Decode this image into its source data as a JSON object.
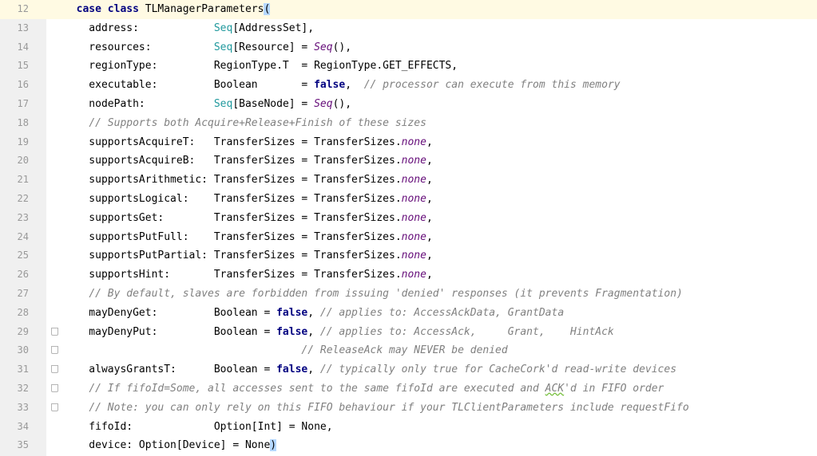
{
  "editor": {
    "current_line": 12,
    "lines": [
      {
        "n": "12",
        "t": [
          [
            "",
            "  "
          ],
          [
            "kw",
            "case"
          ],
          [
            "",
            " "
          ],
          [
            "kw",
            "class"
          ],
          [
            "",
            " TLManagerParameters"
          ],
          [
            "caret",
            "("
          ]
        ]
      },
      {
        "n": "13",
        "t": [
          [
            "",
            "    address:            "
          ],
          [
            "ty",
            "Seq"
          ],
          [
            "",
            "[AddressSet],"
          ]
        ]
      },
      {
        "n": "14",
        "t": [
          [
            "",
            "    resources:          "
          ],
          [
            "ty",
            "Seq"
          ],
          [
            "",
            "[Resource] = "
          ],
          [
            "it",
            "Seq"
          ],
          [
            "",
            "(),"
          ]
        ]
      },
      {
        "n": "15",
        "t": [
          [
            "",
            "    regionType:         RegionType.T  = RegionType.GET_EFFECTS,"
          ]
        ]
      },
      {
        "n": "16",
        "t": [
          [
            "",
            "    executable:         Boolean       = "
          ],
          [
            "kw",
            "false"
          ],
          [
            "",
            ",  "
          ],
          [
            "cm",
            "// processor can execute from this memory"
          ]
        ]
      },
      {
        "n": "17",
        "t": [
          [
            "",
            "    nodePath:           "
          ],
          [
            "ty",
            "Seq"
          ],
          [
            "",
            "[BaseNode] = "
          ],
          [
            "it",
            "Seq"
          ],
          [
            "",
            "(),"
          ]
        ]
      },
      {
        "n": "18",
        "t": [
          [
            "",
            "    "
          ],
          [
            "cm",
            "// Supports both Acquire+Release+Finish of these sizes"
          ]
        ]
      },
      {
        "n": "19",
        "t": [
          [
            "",
            "    supportsAcquireT:   TransferSizes = TransferSizes."
          ],
          [
            "it",
            "none"
          ],
          [
            "",
            ","
          ]
        ]
      },
      {
        "n": "20",
        "t": [
          [
            "",
            "    supportsAcquireB:   TransferSizes = TransferSizes."
          ],
          [
            "it",
            "none"
          ],
          [
            "",
            ","
          ]
        ]
      },
      {
        "n": "21",
        "t": [
          [
            "",
            "    supportsArithmetic: TransferSizes = TransferSizes."
          ],
          [
            "it",
            "none"
          ],
          [
            "",
            ","
          ]
        ]
      },
      {
        "n": "22",
        "t": [
          [
            "",
            "    supportsLogical:    TransferSizes = TransferSizes."
          ],
          [
            "it",
            "none"
          ],
          [
            "",
            ","
          ]
        ]
      },
      {
        "n": "23",
        "t": [
          [
            "",
            "    supportsGet:        TransferSizes = TransferSizes."
          ],
          [
            "it",
            "none"
          ],
          [
            "",
            ","
          ]
        ]
      },
      {
        "n": "24",
        "t": [
          [
            "",
            "    supportsPutFull:    TransferSizes = TransferSizes."
          ],
          [
            "it",
            "none"
          ],
          [
            "",
            ","
          ]
        ]
      },
      {
        "n": "25",
        "t": [
          [
            "",
            "    supportsPutPartial: TransferSizes = TransferSizes."
          ],
          [
            "it",
            "none"
          ],
          [
            "",
            ","
          ]
        ]
      },
      {
        "n": "26",
        "t": [
          [
            "",
            "    supportsHint:       TransferSizes = TransferSizes."
          ],
          [
            "it",
            "none"
          ],
          [
            "",
            ","
          ]
        ]
      },
      {
        "n": "27",
        "t": [
          [
            "",
            "    "
          ],
          [
            "cm",
            "// By default, slaves are forbidden from issuing 'denied' responses (it prevents Fragmentation)"
          ]
        ]
      },
      {
        "n": "28",
        "t": [
          [
            "",
            "    mayDenyGet:         Boolean = "
          ],
          [
            "kw",
            "false"
          ],
          [
            "",
            ", "
          ],
          [
            "cm",
            "// applies to: AccessAckData, GrantData"
          ]
        ]
      },
      {
        "n": "29",
        "fold": true,
        "t": [
          [
            "",
            "    mayDenyPut:         Boolean = "
          ],
          [
            "kw",
            "false"
          ],
          [
            "",
            ", "
          ],
          [
            "cm",
            "// applies to: AccessAck,     Grant,    HintAck"
          ]
        ]
      },
      {
        "n": "30",
        "fold": true,
        "t": [
          [
            "",
            "                                      "
          ],
          [
            "cm",
            "// ReleaseAck may NEVER be denied"
          ]
        ]
      },
      {
        "n": "31",
        "fold": true,
        "t": [
          [
            "",
            "    alwaysGrantsT:      Boolean = "
          ],
          [
            "kw",
            "false"
          ],
          [
            "",
            ", "
          ],
          [
            "cm",
            "// typically only true for CacheCork'd read-write devices"
          ]
        ]
      },
      {
        "n": "32",
        "fold": true,
        "t": [
          [
            "",
            "    "
          ],
          [
            "cm",
            "// If fifoId=Some, all accesses sent to the same fifoId are executed and "
          ],
          [
            "cm squig",
            "ACK"
          ],
          [
            "cm",
            "'d in FIFO order"
          ]
        ]
      },
      {
        "n": "33",
        "fold": true,
        "t": [
          [
            "",
            "    "
          ],
          [
            "cm",
            "// Note: you can only rely on this FIFO behaviour if your TLClientParameters include requestFifo"
          ]
        ]
      },
      {
        "n": "34",
        "t": [
          [
            "",
            "    fifoId:             Option[Int] = None,"
          ]
        ]
      },
      {
        "n": "35",
        "t": [
          [
            "",
            "    device: Option[Device] = None"
          ],
          [
            "caret",
            ")"
          ]
        ]
      }
    ]
  }
}
